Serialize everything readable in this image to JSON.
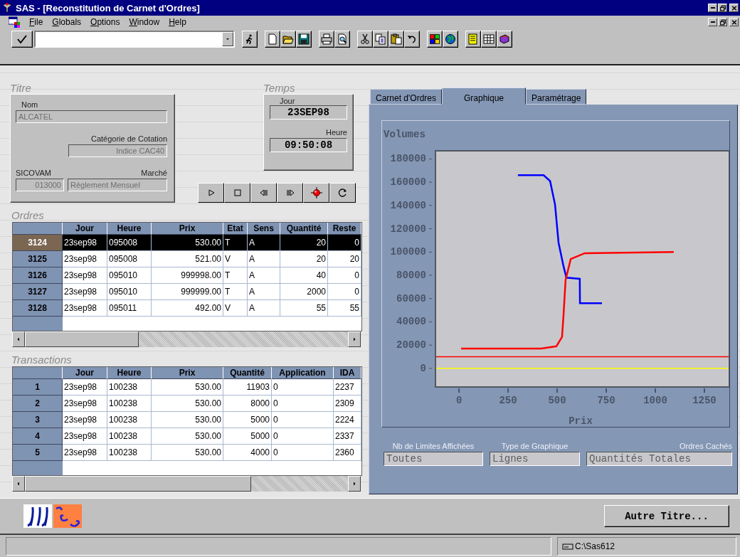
{
  "window": {
    "title": "SAS - [Reconstitution de Carnet d'Ordres]"
  },
  "menu": [
    "File",
    "Globals",
    "Options",
    "Window",
    "Help"
  ],
  "titre": {
    "heading": "Titre",
    "fields": [
      {
        "label": "Nom",
        "value": "ALCATEL"
      },
      {
        "label": "Catégorie de Cotation",
        "value": "Indice CAC40"
      },
      {
        "label": "SICOVAM",
        "value": "013000"
      },
      {
        "label": "Marché",
        "value": "Règlement Mensuel"
      }
    ]
  },
  "temps": {
    "heading": "Temps",
    "jour_label": "Jour",
    "jour": "23SEP98",
    "heure_label": "Heure",
    "heure": "09:50:08"
  },
  "ordres": {
    "heading": "Ordres",
    "columns": [
      "Jour",
      "Heure",
      "Prix",
      "Etat",
      "Sens",
      "Quantité",
      "Reste"
    ],
    "rows": [
      {
        "id": "3124",
        "selected": true,
        "cells": [
          "23sep98",
          "095008",
          "530.00",
          "T",
          "A",
          "20",
          "0"
        ]
      },
      {
        "id": "3125",
        "selected": false,
        "cells": [
          "23sep98",
          "095008",
          "521.00",
          "V",
          "A",
          "20",
          "20"
        ]
      },
      {
        "id": "3126",
        "selected": false,
        "cells": [
          "23sep98",
          "095010",
          "999998.00",
          "T",
          "A",
          "40",
          "0"
        ]
      },
      {
        "id": "3127",
        "selected": false,
        "cells": [
          "23sep98",
          "095010",
          "999999.00",
          "T",
          "A",
          "2000",
          "0"
        ]
      },
      {
        "id": "3128",
        "selected": false,
        "cells": [
          "23sep98",
          "095011",
          "492.00",
          "V",
          "A",
          "55",
          "55"
        ]
      }
    ]
  },
  "transactions": {
    "heading": "Transactions",
    "columns": [
      "Jour",
      "Heure",
      "Prix",
      "Quantité",
      "Application",
      "IDA"
    ],
    "rows": [
      {
        "id": "1",
        "cells": [
          "23sep98",
          "100238",
          "530.00",
          "11903",
          "0",
          "2237"
        ]
      },
      {
        "id": "2",
        "cells": [
          "23sep98",
          "100238",
          "530.00",
          "8000",
          "0",
          "2309"
        ]
      },
      {
        "id": "3",
        "cells": [
          "23sep98",
          "100238",
          "530.00",
          "5000",
          "0",
          "2224"
        ]
      },
      {
        "id": "4",
        "cells": [
          "23sep98",
          "100238",
          "530.00",
          "5000",
          "0",
          "2337"
        ]
      },
      {
        "id": "5",
        "cells": [
          "23sep98",
          "100238",
          "530.00",
          "4000",
          "0",
          "2360"
        ]
      }
    ]
  },
  "right_panel": {
    "tabs": [
      {
        "label": "Carnet d'Ordres",
        "selected": false
      },
      {
        "label": "Graphique",
        "selected": true
      },
      {
        "label": "Paramétrage",
        "selected": false
      }
    ],
    "chart_data": {
      "type": "line",
      "xlabel": "Prix",
      "ylabel": "Volumes",
      "x": [
        11,
        300,
        417,
        431,
        464,
        489,
        496,
        507,
        525,
        532,
        543,
        547,
        569,
        615,
        616,
        641,
        728,
        1094
      ],
      "series": [
        {
          "color": "#0000ff",
          "values": [
            null,
            166000,
            null,
            166000,
            161000,
            141000,
            null,
            108000,
            null,
            88000,
            null,
            78000,
            null,
            77000,
            56000,
            null,
            56000,
            null
          ]
        },
        {
          "color": "#ff0000",
          "values": [
            17000,
            17000,
            17000,
            null,
            null,
            null,
            19000,
            null,
            27000,
            45000,
            76000,
            null,
            94000,
            null,
            null,
            99000,
            null,
            100000
          ]
        }
      ],
      "xlim": [
        -120,
        1377
      ],
      "ylim": [
        -16000,
        187000
      ],
      "xticks": [
        0,
        250,
        500,
        750,
        1000,
        1250
      ],
      "yticks": [
        0,
        20000,
        40000,
        60000,
        80000,
        100000,
        120000,
        140000,
        160000,
        180000
      ],
      "ref_lines": [
        {
          "axis": "y",
          "value": 10000,
          "color": "#ff0000"
        },
        {
          "axis": "y",
          "value": 0,
          "color": "#ffff00"
        }
      ]
    },
    "settings": [
      {
        "label": "Nb de Limites Affichées",
        "value": "Toutes"
      },
      {
        "label": "Type de Graphique",
        "value": "Lignes"
      },
      {
        "label": "Ordres Cachés",
        "value": "Quantités Totales"
      }
    ]
  },
  "footer_button": "Autre Titre...",
  "status_bar": {
    "path": "C:\\Sas612"
  }
}
